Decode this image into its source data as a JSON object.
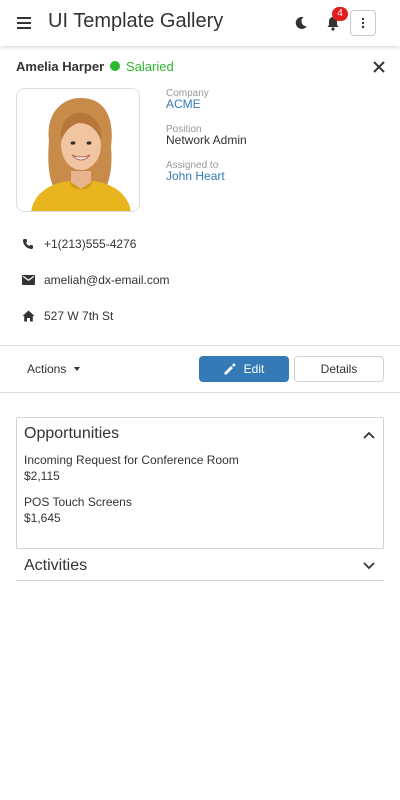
{
  "header": {
    "title": "UI Template Gallery",
    "notification_count": "4",
    "menu_icon": "hamburger-icon",
    "theme_icon": "moon-icon",
    "notification_icon": "bell-icon",
    "more_icon": "vertical-ellipsis-icon"
  },
  "contact": {
    "name": "Amelia Harper",
    "status": "Salaried",
    "status_color": "#2eb82e",
    "company_label": "Company",
    "company": "ACME",
    "position_label": "Position",
    "position": "Network Admin",
    "assigned_label": "Assigned to",
    "assigned": "John Heart",
    "phone": "+1(213)555-4276",
    "email": "ameliah@dx-email.com",
    "address": "527 W 7th St"
  },
  "toolbar": {
    "actions_label": "Actions",
    "edit_label": "Edit",
    "details_label": "Details",
    "accent": "#337ab7"
  },
  "opportunities": {
    "title": "Opportunities",
    "items": [
      {
        "name": "Incoming Request for Conference Room",
        "amount": "$2,115"
      },
      {
        "name": "POS Touch Screens",
        "amount": "$1,645"
      }
    ]
  },
  "activities": {
    "title": "Activities"
  }
}
